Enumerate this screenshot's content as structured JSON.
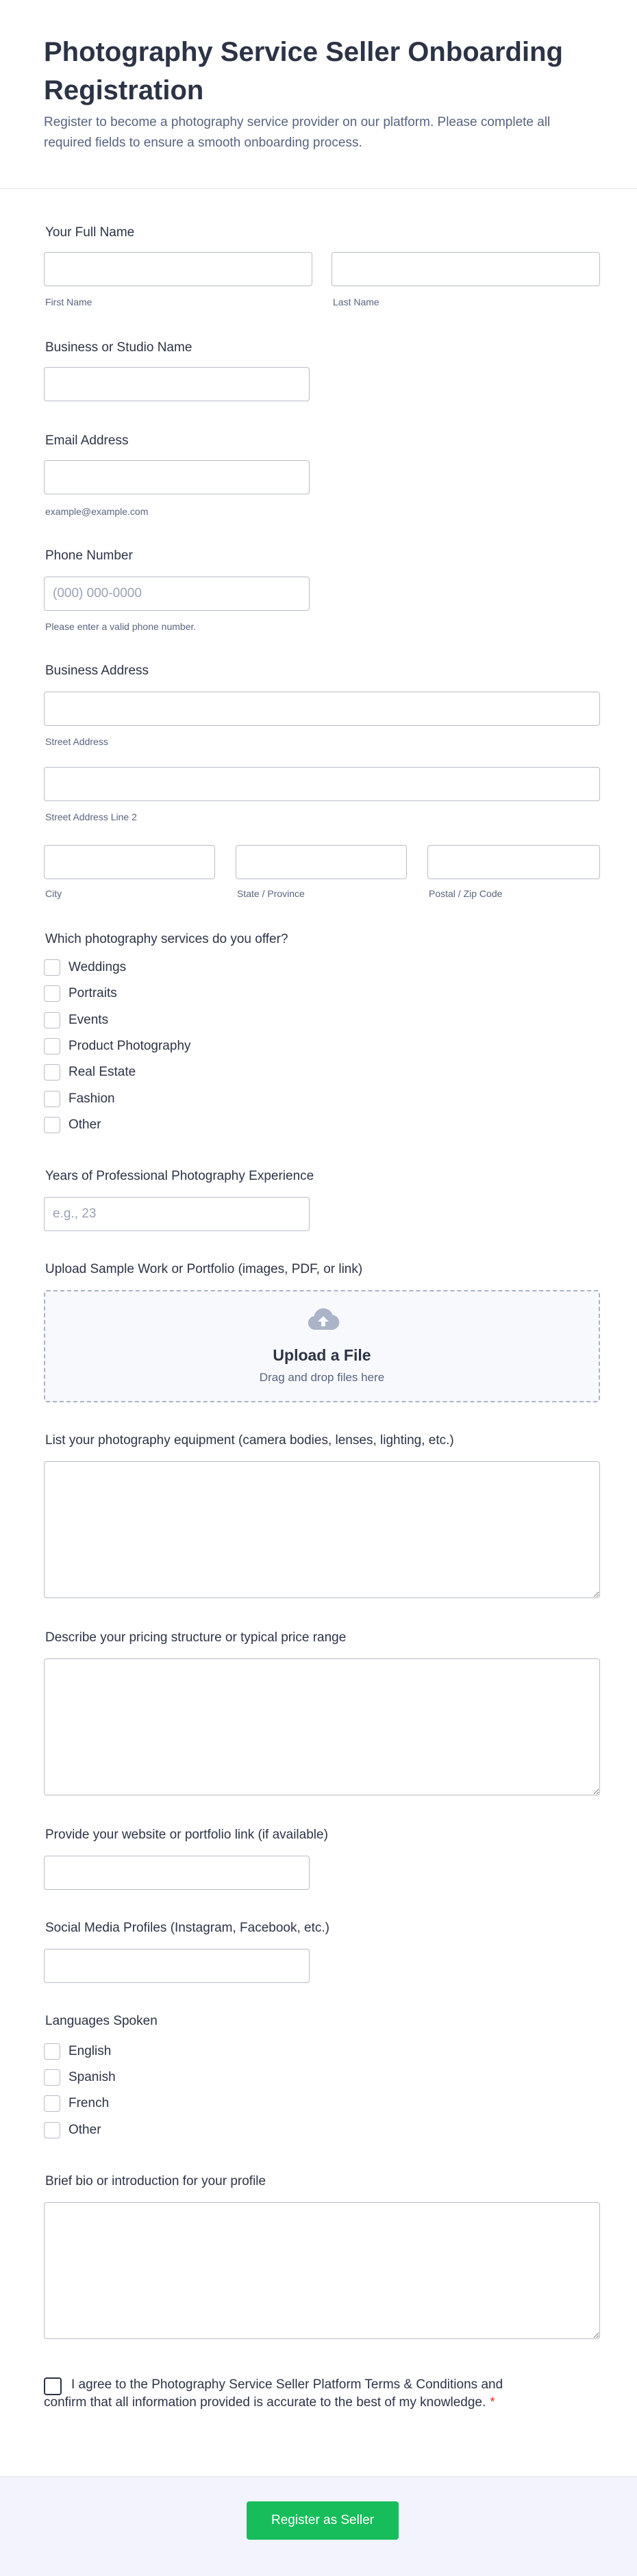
{
  "header": {
    "title": "Photography Service Seller Onboarding Registration",
    "subtitle": "Register to become a photography service provider on our platform. Please complete all required fields to ensure a smooth onboarding process."
  },
  "full_name": {
    "label": "Your Full Name",
    "first_sublabel": "First Name",
    "last_sublabel": "Last Name"
  },
  "business_name": {
    "label": "Business or Studio Name"
  },
  "email": {
    "label": "Email Address",
    "sublabel": "example@example.com"
  },
  "phone": {
    "label": "Phone Number",
    "placeholder": "(000) 000-0000",
    "sublabel": "Please enter a valid phone number."
  },
  "address": {
    "label": "Business Address",
    "street_sublabel": "Street Address",
    "street2_sublabel": "Street Address Line 2",
    "city_sublabel": "City",
    "state_sublabel": "State / Province",
    "postal_sublabel": "Postal / Zip Code"
  },
  "services": {
    "label": "Which photography services do you offer?",
    "options": [
      "Weddings",
      "Portraits",
      "Events",
      "Product Photography",
      "Real Estate",
      "Fashion",
      "Other"
    ]
  },
  "experience": {
    "label": "Years of Professional Photography Experience",
    "placeholder": "e.g., 23"
  },
  "upload": {
    "label": "Upload Sample Work or Portfolio (images, PDF, or link)",
    "title": "Upload a File",
    "subtitle": "Drag and drop files here",
    "icon": "cloud-upload-icon"
  },
  "equipment": {
    "label": "List your photography equipment (camera bodies, lenses, lighting, etc.)"
  },
  "pricing": {
    "label": "Describe your pricing structure or typical price range"
  },
  "website": {
    "label": "Provide your website or portfolio link (if available)"
  },
  "social": {
    "label": "Social Media Profiles (Instagram, Facebook, etc.)"
  },
  "languages": {
    "label": "Languages Spoken",
    "options": [
      "English",
      "Spanish",
      "French",
      "Other"
    ]
  },
  "bio": {
    "label": "Brief bio or introduction for your profile"
  },
  "terms": {
    "text": "I agree to the Photography Service Seller Platform Terms & Conditions and confirm that all information provided is accurate to the best of my knowledge.",
    "required_mark": "*"
  },
  "submit": {
    "label": "Register as Seller"
  },
  "colors": {
    "accent": "#18bd5b",
    "text": "#2c3345",
    "muted": "#57647e",
    "required": "#e2372d",
    "footer_bg": "#f3f3fe"
  }
}
